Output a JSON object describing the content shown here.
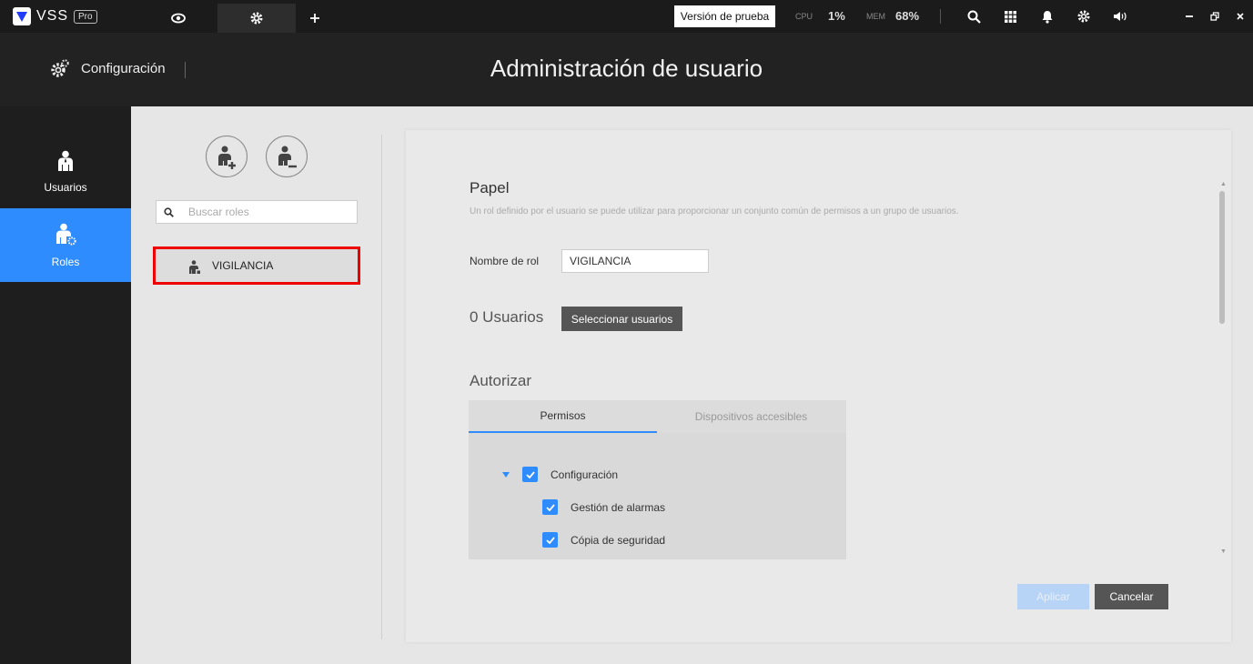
{
  "topbar": {
    "brand": "VSS",
    "badge": "Pro",
    "trial_label": "Versión de prueba",
    "cpu_label": "CPU",
    "cpu_value": "1%",
    "mem_label": "MEM",
    "mem_value": "68%"
  },
  "header": {
    "section_label": "Configuración",
    "title": "Administración de usuario"
  },
  "sidebar": {
    "items": [
      {
        "label": "Usuarios"
      },
      {
        "label": "Roles"
      }
    ]
  },
  "roles": {
    "search_placeholder": "Buscar roles",
    "items": [
      {
        "label": "VIGILANCIA"
      }
    ]
  },
  "role_form": {
    "section_title": "Papel",
    "description": "Un rol definido por el usuario se puede utilizar para proporcionar un conjunto común de permisos a un grupo de usuarios.",
    "name_label": "Nombre de rol",
    "name_value": "VIGILANCIA",
    "users_count": "0 Usuarios",
    "select_users_label": "Seleccionar usuarios",
    "authorize_title": "Autorizar",
    "tabs": [
      {
        "label": "Permisos"
      },
      {
        "label": "Dispositivos accesibles"
      }
    ],
    "permissions": [
      {
        "label": "Configuración"
      },
      {
        "label": "Gestión de alarmas"
      },
      {
        "label": "Cópia de seguridad"
      }
    ],
    "apply_label": "Aplicar",
    "cancel_label": "Cancelar"
  },
  "colors": {
    "accent": "#2f8cff",
    "highlight_border": "#ee0000",
    "topbar_bg": "#1b1b1b",
    "header_bg": "#222222"
  }
}
